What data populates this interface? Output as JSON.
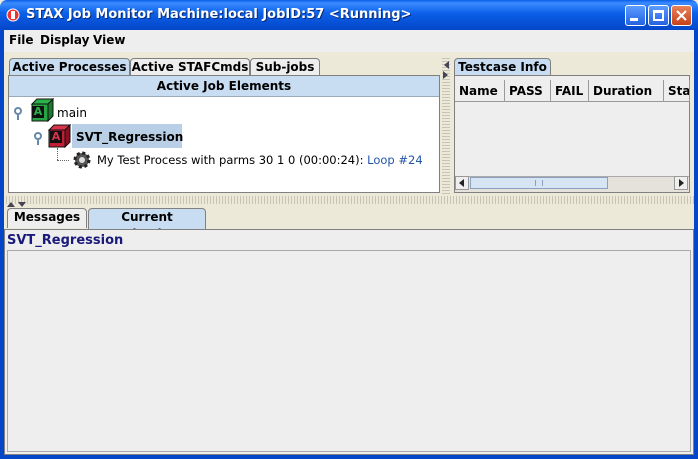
{
  "window": {
    "title": "STAX Job Monitor Machine:local JobID:57  <Running>"
  },
  "menu": {
    "items": [
      "File",
      "Display",
      "View"
    ]
  },
  "left_tabs": [
    "Active Processes",
    "Active STAFCmds",
    "Sub-jobs"
  ],
  "active_panel": {
    "header": "Active Job Elements"
  },
  "tree": {
    "root": {
      "label": "main",
      "icon_letter": "A",
      "icon": "green-block-icon"
    },
    "child": {
      "label": "SVT_Regression",
      "icon_letter": "A",
      "icon": "red-block-icon"
    },
    "process": {
      "text": "My Test Process with parms 30 1 0  (00:00:24): ",
      "loop": "Loop #24",
      "icon": "gear-icon"
    }
  },
  "right_tabs": [
    "Testcase Info"
  ],
  "testcase_table": {
    "columns": [
      "Name",
      "PASS",
      "FAIL",
      "Duration",
      "Sta"
    ]
  },
  "bottom_tabs": [
    "Messages",
    "Current Selection"
  ],
  "current_selection": {
    "title": "SVT_Regression"
  },
  "colors": {
    "titlebar": "#0A5FE8",
    "tab_selected": "#C8DDF2",
    "link": "#2255AA",
    "selection_text": "#1A1A7A"
  }
}
